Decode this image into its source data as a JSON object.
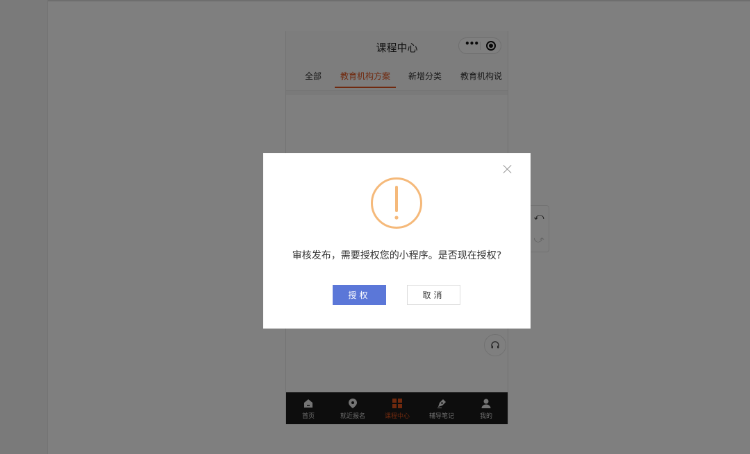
{
  "phone": {
    "title": "课程中心",
    "tabs": [
      {
        "label": "全部"
      },
      {
        "label": "教育机构方案"
      },
      {
        "label": "新增分类"
      },
      {
        "label": "教育机构说"
      }
    ],
    "tabbar": [
      {
        "label": "首页",
        "icon": "home-icon"
      },
      {
        "label": "就近报名",
        "icon": "location-pin-icon"
      },
      {
        "label": "课程中心",
        "icon": "grid-icon"
      },
      {
        "label": "辅导笔记",
        "icon": "pen-icon"
      },
      {
        "label": "我的",
        "icon": "user-icon"
      }
    ]
  },
  "dialog": {
    "message": "审核发布，需要授权您的小程序。是否现在授权?",
    "confirm_label": "授权",
    "cancel_label": "取消"
  },
  "colors": {
    "accent": "#e0531c",
    "primary_button": "#5b77d8",
    "warning": "#f5b97a",
    "tabbar_bg": "#1a1a1a"
  }
}
